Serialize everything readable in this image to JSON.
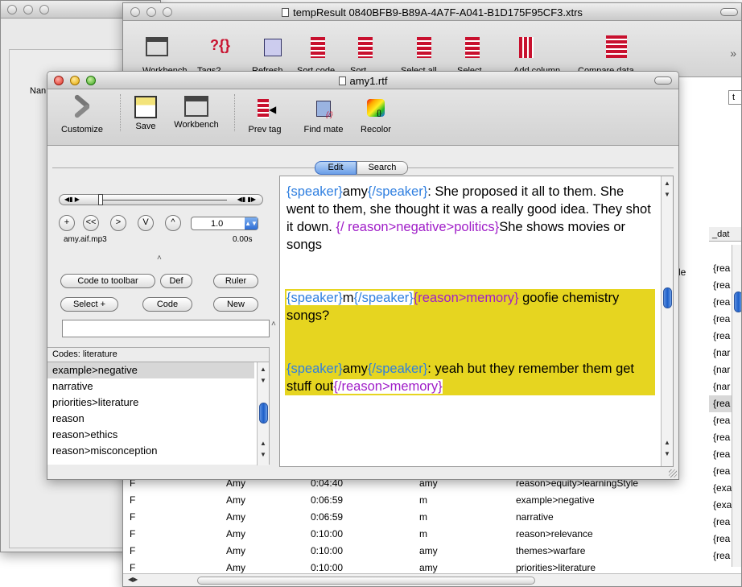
{
  "back_window": {
    "title": "",
    "side_label": "Nan"
  },
  "xtrs_window": {
    "title": "tempResult 0840BFB9-B89A-4A7F-A041-B1D175F95CF3.xtrs",
    "toolbar": [
      "Workbench",
      "Tags?",
      "Refresh",
      "Sort code",
      "Sort",
      "Select all",
      "Select",
      "Add column",
      "Compare data"
    ],
    "overflow": "»",
    "right_col_header": "_dat",
    "right_col_values": [
      "{rea",
      "{rea",
      "{rea",
      "{rea",
      "{rea",
      "{nar",
      "{nar",
      "{nar",
      "{rea",
      "{rea",
      "{rea",
      "{rea",
      "{rea",
      "{exa",
      "{exa",
      "{rea",
      "{rea",
      "{rea"
    ],
    "right_col_top_cell": "le",
    "search_stub": "t",
    "rows": [
      {
        "c1": "F",
        "c2": "Amy",
        "c3": "0:04:40",
        "c4": "amy",
        "c5": "reason>equity>learningStyle"
      },
      {
        "c1": "F",
        "c2": "Amy",
        "c3": "0:06:59",
        "c4": "m",
        "c5": "example>negative"
      },
      {
        "c1": "F",
        "c2": "Amy",
        "c3": "0:06:59",
        "c4": "m",
        "c5": "narrative"
      },
      {
        "c1": "F",
        "c2": "Amy",
        "c3": "0:10:00",
        "c4": "m",
        "c5": "reason>relevance"
      },
      {
        "c1": "F",
        "c2": "Amy",
        "c3": "0:10:00",
        "c4": "amy",
        "c5": "themes>warfare"
      },
      {
        "c1": "F",
        "c2": "Amy",
        "c3": "0:10:00",
        "c4": "amy",
        "c5": "priorities>literature"
      }
    ]
  },
  "rtf_window": {
    "title": "amy1.rtf",
    "toolbar": {
      "customize": "Customize",
      "save": "Save",
      "workbench": "Workbench",
      "prev_tag": "Prev tag",
      "find_mate": "Find mate",
      "recolor": "Recolor"
    },
    "tabs": {
      "edit": "Edit",
      "search": "Search"
    },
    "player": {
      "rate": "1.0",
      "filename": "amy.aif.mp3",
      "time": "0.00s",
      "buttons": {
        "plus": "+",
        "rewind": "<<",
        "forward": ">",
        "v": "V",
        "caret": "^"
      }
    },
    "buttons": {
      "code_to_toolbar": "Code to toolbar",
      "def": "Def",
      "ruler": "Ruler",
      "select_plus": "Select +",
      "code": "Code",
      "new": "New"
    },
    "codes_header": "Codes: literature",
    "codes": [
      "example>negative",
      "narrative",
      "priorities>literature",
      "reason",
      "reason>ethics",
      "reason>misconception"
    ],
    "text": {
      "p1_open": "{speaker}",
      "p1_name": "amy",
      "p1_close": "{/speaker}",
      "p1_body": ": She proposed it all to them. She went to them, she thought it was a really good idea. They shot it down. ",
      "p1_tag_close": "{/ reason>negative>politics}",
      "p1_tail": "She shows movies or songs",
      "p2_open": "{speaker}",
      "p2_name": "m",
      "p2_close": "{/speaker}",
      "p2_tag_open": "{reason>memory}",
      "p2_body": " goofie chemistry songs?",
      "p3_open": "{speaker}",
      "p3_name": "amy",
      "p3_close": "{/speaker}",
      "p3_body": ": yeah but they remember them get stuff out",
      "p3_tag_close": "{/reason>memory}"
    },
    "colors": {
      "tag_blue": "#2f7fe0",
      "tag_purple": "#a01ec8",
      "highlight": "#e6d520"
    }
  }
}
